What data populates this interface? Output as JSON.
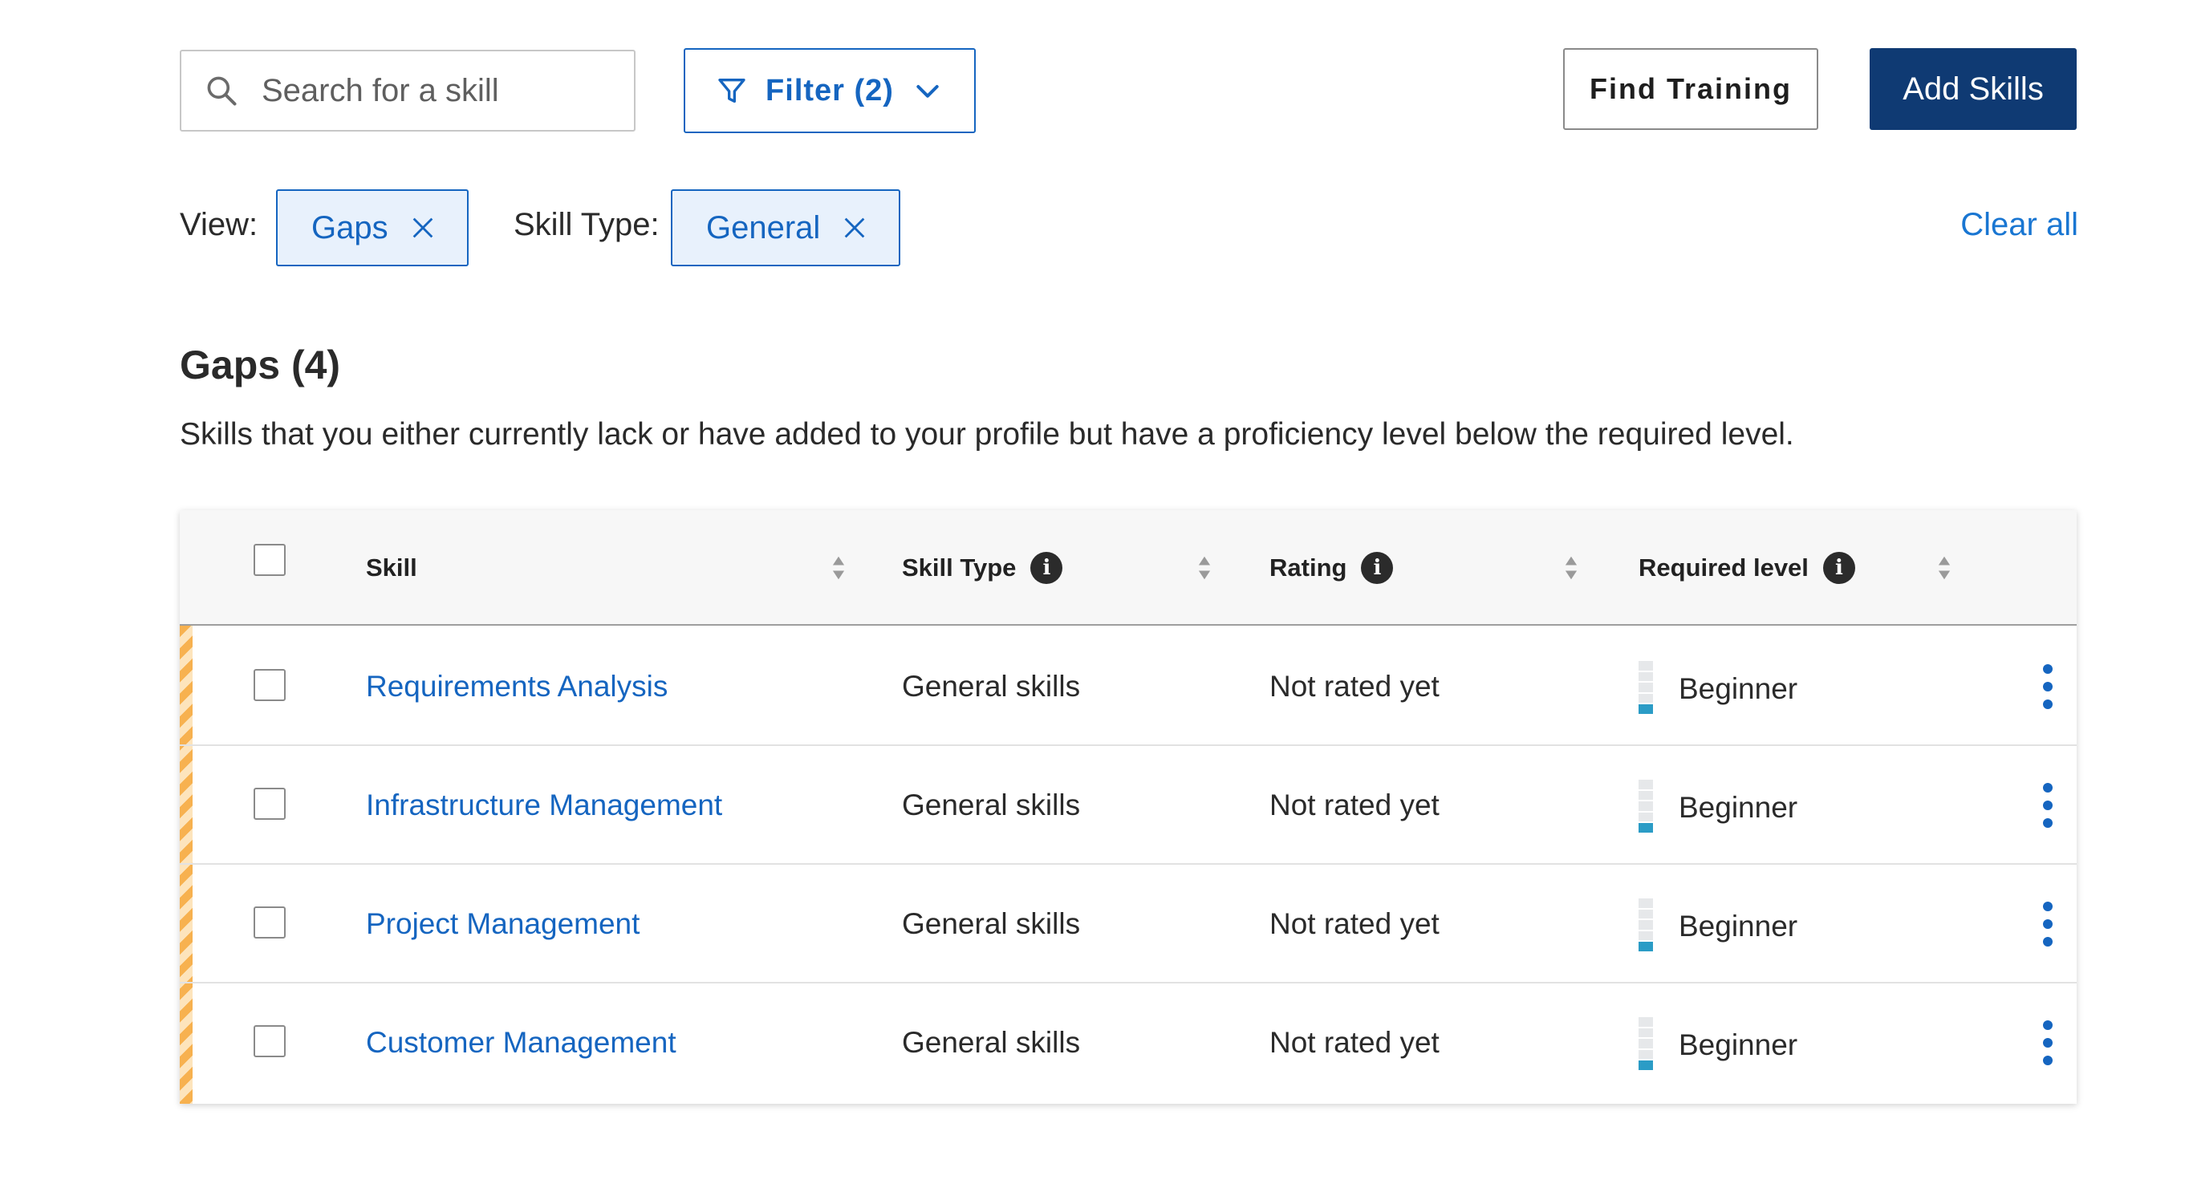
{
  "toolbar": {
    "search_placeholder": "Search for a skill",
    "filter_label": "Filter (2)",
    "find_training_label": "Find Training",
    "add_skills_label": "Add Skills"
  },
  "filters": {
    "view_label": "View:",
    "view_chip": "Gaps",
    "skill_type_label": "Skill Type:",
    "skill_type_chip": "General",
    "clear_all": "Clear all"
  },
  "section": {
    "title": "Gaps (4)",
    "description": "Skills that you either currently lack or have added to your profile but have a proficiency level below the required level."
  },
  "table": {
    "headers": {
      "skill": "Skill",
      "skill_type": "Skill Type",
      "rating": "Rating",
      "required_level": "Required level",
      "info_glyph": "i"
    },
    "rows": [
      {
        "skill": "Requirements Analysis",
        "skill_type": "General skills",
        "rating": "Not rated yet",
        "required_level": "Beginner",
        "level": 1,
        "level_max": 5
      },
      {
        "skill": "Infrastructure Management",
        "skill_type": "General skills",
        "rating": "Not rated yet",
        "required_level": "Beginner",
        "level": 1,
        "level_max": 5
      },
      {
        "skill": "Project Management",
        "skill_type": "General skills",
        "rating": "Not rated yet",
        "required_level": "Beginner",
        "level": 1,
        "level_max": 5
      },
      {
        "skill": "Customer Management",
        "skill_type": "General skills",
        "rating": "Not rated yet",
        "required_level": "Beginner",
        "level": 1,
        "level_max": 5
      }
    ]
  },
  "colors": {
    "primary_blue": "#1565c0",
    "navy_button": "#0f3a73",
    "chip_background": "#e8f1fc",
    "level_fill": "#2b9cc6",
    "gap_stripe": "#f7b14f"
  },
  "icons": {
    "search": "search-icon",
    "filter": "filter-funnel-icon",
    "dropdown": "chevron-down-icon",
    "remove_chip": "close-icon",
    "sort": "sort-icon",
    "info": "info-icon",
    "row_menu": "more-vertical-icon"
  }
}
